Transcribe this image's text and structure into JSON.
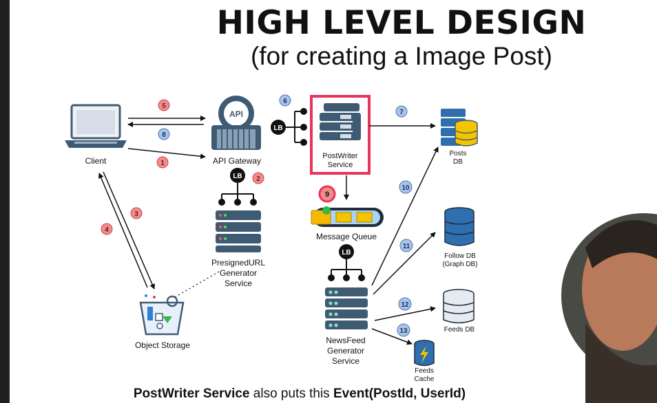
{
  "title": "HIGH LEVEL DESIGN",
  "subtitle": "(for creating a Image Post)",
  "nodes": {
    "client": "Client",
    "api_gateway": "API Gateway",
    "api_badge": "API",
    "lb": "LB",
    "postwriter_line1": "PostWriter",
    "postwriter_line2": "Service",
    "posts_db_line1": "Posts",
    "posts_db_line2": "DB",
    "message_queue": "Message Queue",
    "presigned_line1": "PresignedURL",
    "presigned_line2": "Generator",
    "presigned_line3": "Service",
    "object_storage": "Object Storage",
    "newsfeed_line1": "NewsFeed",
    "newsfeed_line2": "Generator",
    "newsfeed_line3": "Service",
    "follow_db_line1": "Follow DB",
    "follow_db_line2": "(Graph DB)",
    "feeds_db": "Feeds DB",
    "feeds_cache_line1": "Feeds",
    "feeds_cache_line2": "Cache"
  },
  "steps": [
    "1",
    "2",
    "3",
    "4",
    "5",
    "6",
    "7",
    "8",
    "9",
    "10",
    "11",
    "12",
    "13"
  ],
  "caption": {
    "part1": "PostWriter Service",
    "part2": " also puts this ",
    "part3": "Event(PostId, UserId)"
  },
  "colors": {
    "red_step": "#f08c8c",
    "blue_step": "#a9c4ea",
    "highlight": "#e8345a",
    "server": "#3f5b74",
    "db_blue": "#2f6fb0",
    "db_yellow": "#f5c400"
  }
}
